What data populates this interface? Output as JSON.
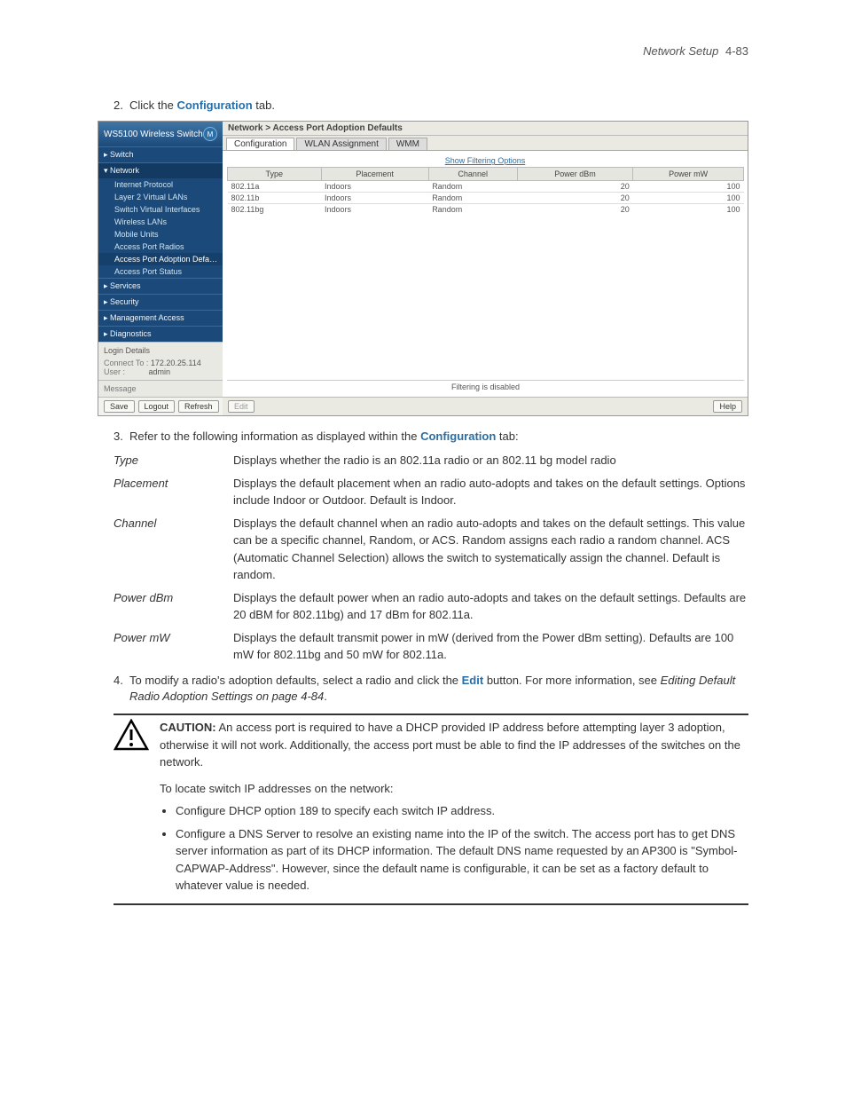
{
  "header": {
    "section": "Network Setup",
    "pagenum": "4-83"
  },
  "steps": {
    "s2_a": "Click the ",
    "s2_b": "Configuration",
    "s2_c": " tab.",
    "s3_a": "Refer to the following information as displayed within the ",
    "s3_b": "Configuration",
    "s3_c": " tab:",
    "s4_a": "To modify a radio's adoption defaults, select a radio and click the ",
    "s4_b": "Edit",
    "s4_c": " button. For more information, see ",
    "s4_d": "Editing Default Radio Adoption Settings on page 4-84",
    "s4_e": "."
  },
  "screenshot": {
    "brand": "WS5100 Wireless Switch",
    "nav": {
      "switch": "▸ Switch",
      "network": "▾ Network",
      "items": [
        "Internet Protocol",
        "Layer 2 Virtual LANs",
        "Switch Virtual Interfaces",
        "Wireless LANs",
        "Mobile Units",
        "Access Port Radios",
        "Access Port Adoption Defaults",
        "Access Port Status"
      ],
      "services": "▸ Services",
      "security": "▸ Security",
      "mgmt": "▸ Management Access",
      "diag": "▸ Diagnostics"
    },
    "login": {
      "title": "Login Details",
      "connect_lbl": "Connect To :",
      "connect_val": "172.20.25.114",
      "user_lbl": "User :",
      "user_val": "admin"
    },
    "message": "Message",
    "footer": {
      "save": "Save",
      "logout": "Logout",
      "refresh": "Refresh"
    },
    "breadcrumb": "Network > Access Port Adoption Defaults",
    "tabs": [
      "Configuration",
      "WLAN Assignment",
      "WMM"
    ],
    "filter_link": "Show Filtering Options",
    "table": {
      "headers": [
        "Type",
        "Placement",
        "Channel",
        "Power dBm",
        "Power mW"
      ],
      "rows": [
        [
          "802.11a",
          "Indoors",
          "Random",
          "20",
          "100"
        ],
        [
          "802.11b",
          "Indoors",
          "Random",
          "20",
          "100"
        ],
        [
          "802.11bg",
          "Indoors",
          "Random",
          "20",
          "100"
        ]
      ]
    },
    "filter_status": "Filtering is disabled",
    "main_footer": {
      "edit": "Edit",
      "help": "Help"
    }
  },
  "defs": {
    "type": {
      "term": "Type",
      "body": "Displays whether the radio is an 802.11a radio or an 802.11 bg model radio"
    },
    "placement": {
      "term": "Placement",
      "body": "Displays the default placement when an radio auto-adopts and takes on the default settings. Options include Indoor or Outdoor. Default is Indoor."
    },
    "channel": {
      "term": "Channel",
      "body": "Displays the default channel when an radio auto-adopts and takes on the default settings. This value can be a specific channel, Random, or ACS. Random assigns each radio a random channel. ACS (Automatic Channel Selection) allows the switch to systematically assign the channel. Default is random."
    },
    "powerdbm": {
      "term": "Power dBm",
      "body": "Displays the default power when an radio auto-adopts and takes on the default settings. Defaults are 20 dBM for 802.11bg) and 17 dBm for 802.11a."
    },
    "powermw": {
      "term": "Power mW",
      "body": "Displays the default transmit power in mW (derived from the Power dBm setting). Defaults are 100 mW for 802.11bg and 50 mW for 802.11a."
    }
  },
  "caution": {
    "label": "CAUTION:",
    "body": "An access port is required to have a DHCP provided IP address before attempting layer 3 adoption, otherwise it will not work. Additionally, the access port must be able to find the IP addresses of the switches on the network.",
    "locate": "To locate switch IP addresses on the network:",
    "b1": "Configure DHCP option 189 to specify each switch IP address.",
    "b2": "Configure a DNS Server to resolve an existing name into the IP of the switch. The access port has to get DNS server information as part of its DHCP information. The default DNS name requested by an AP300 is \"Symbol-CAPWAP-Address\". However, since the default name is configurable, it can be set as a factory default to whatever value is needed."
  }
}
